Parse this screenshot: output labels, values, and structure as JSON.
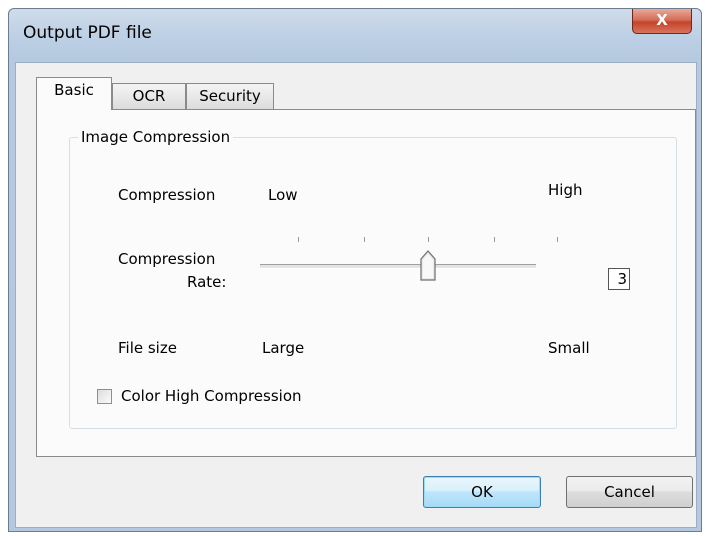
{
  "window": {
    "title": "Output PDF file",
    "close_glyph": "X"
  },
  "tabs": [
    {
      "label": "Basic",
      "active": true
    },
    {
      "label": "OCR",
      "active": false
    },
    {
      "label": "Security",
      "active": false
    }
  ],
  "image_compression": {
    "group_label": "Image Compression",
    "compression_label": "Compression",
    "low_label": "Low",
    "high_label": "High",
    "rate_label_line1": "Compression",
    "rate_label_line2": "Rate:",
    "rate_value": "3",
    "rate_min": 1,
    "rate_max": 5,
    "file_size_label": "File size",
    "large_label": "Large",
    "small_label": "Small",
    "color_high_compression_label": "Color High Compression",
    "color_high_compression_checked": false
  },
  "buttons": {
    "ok_label": "OK",
    "cancel_label": "Cancel"
  }
}
